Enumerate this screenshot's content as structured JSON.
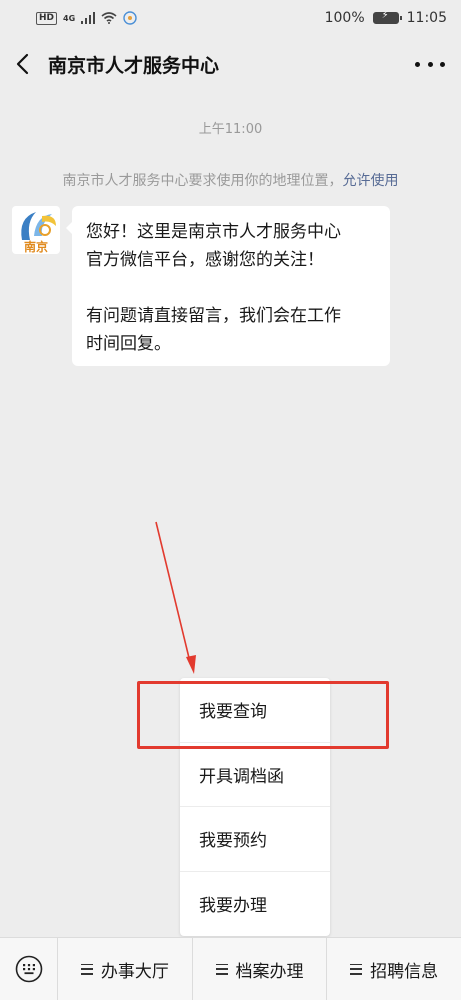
{
  "status_bar": {
    "network": "4G",
    "battery": "100%",
    "time": "11:05"
  },
  "nav": {
    "title": "南京市人才服务中心"
  },
  "chat": {
    "timestamp": "上午11:00",
    "system_note": "南京市人才服务中心要求使用你的地理位置，",
    "system_link": "允许使用",
    "avatar_text": "南京",
    "message": {
      "line1": "您好！这里是南京市人才服务中心",
      "line2": "官方微信平台，感谢您的关注！",
      "line3": "有问题请直接留言，我们会在工作",
      "line4": "时间回复。"
    }
  },
  "menu": {
    "items": [
      {
        "label": "我要查询"
      },
      {
        "label": "开具调档函"
      },
      {
        "label": "我要预约"
      },
      {
        "label": "我要办理"
      }
    ]
  },
  "bottom_bar": {
    "items": [
      {
        "label": "办事大厅"
      },
      {
        "label": "档案办理"
      },
      {
        "label": "招聘信息"
      }
    ]
  },
  "colors": {
    "highlight": "#e23a2e",
    "link": "#576b95",
    "background": "#ededed"
  }
}
